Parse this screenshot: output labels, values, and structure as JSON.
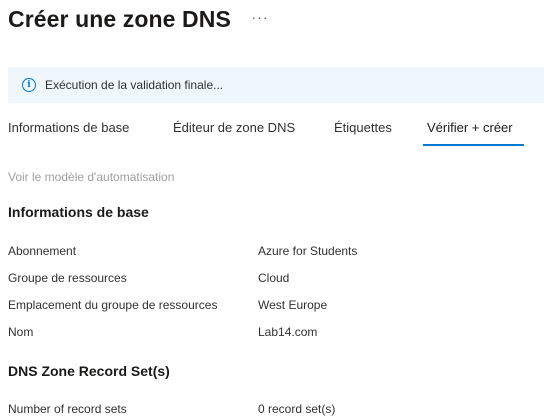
{
  "header": {
    "title": "Créer une zone DNS",
    "more_label": "···"
  },
  "banner": {
    "icon": "info-icon",
    "text": "Exécution de la validation finale..."
  },
  "tabs": [
    {
      "label": "Informations de base",
      "active": false
    },
    {
      "label": "Éditeur de zone DNS",
      "active": false
    },
    {
      "label": "Étiquettes",
      "active": false
    },
    {
      "label": "Vérifier + créer",
      "active": true
    }
  ],
  "automation_link": "Voir le modèle d'automatisation",
  "basics": {
    "title": "Informations de base",
    "rows": [
      {
        "label": "Abonnement",
        "value": "Azure for Students"
      },
      {
        "label": "Groupe de ressources",
        "value": "Cloud"
      },
      {
        "label": "Emplacement du groupe de ressources",
        "value": "West Europe"
      },
      {
        "label": "Nom",
        "value": "Lab14.com"
      }
    ]
  },
  "record_sets": {
    "title": "DNS Zone Record Set(s)",
    "rows": [
      {
        "label": "Number of record sets",
        "value": "0 record set(s)"
      }
    ]
  },
  "colors": {
    "accent": "#0078d4",
    "banner_bg": "#eff6fc",
    "muted_text": "#a19f9d"
  }
}
